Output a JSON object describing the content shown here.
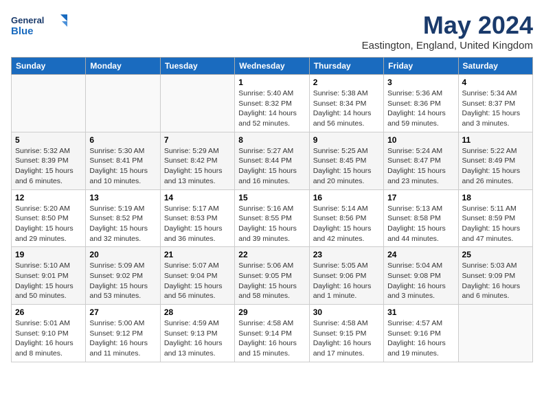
{
  "logo": {
    "text_general": "General",
    "text_blue": "Blue"
  },
  "header": {
    "month_year": "May 2024",
    "location": "Eastington, England, United Kingdom"
  },
  "days_of_week": [
    "Sunday",
    "Monday",
    "Tuesday",
    "Wednesday",
    "Thursday",
    "Friday",
    "Saturday"
  ],
  "weeks": [
    [
      {
        "day": "",
        "info": ""
      },
      {
        "day": "",
        "info": ""
      },
      {
        "day": "",
        "info": ""
      },
      {
        "day": "1",
        "info": "Sunrise: 5:40 AM\nSunset: 8:32 PM\nDaylight: 14 hours and 52 minutes."
      },
      {
        "day": "2",
        "info": "Sunrise: 5:38 AM\nSunset: 8:34 PM\nDaylight: 14 hours and 56 minutes."
      },
      {
        "day": "3",
        "info": "Sunrise: 5:36 AM\nSunset: 8:36 PM\nDaylight: 14 hours and 59 minutes."
      },
      {
        "day": "4",
        "info": "Sunrise: 5:34 AM\nSunset: 8:37 PM\nDaylight: 15 hours and 3 minutes."
      }
    ],
    [
      {
        "day": "5",
        "info": "Sunrise: 5:32 AM\nSunset: 8:39 PM\nDaylight: 15 hours and 6 minutes."
      },
      {
        "day": "6",
        "info": "Sunrise: 5:30 AM\nSunset: 8:41 PM\nDaylight: 15 hours and 10 minutes."
      },
      {
        "day": "7",
        "info": "Sunrise: 5:29 AM\nSunset: 8:42 PM\nDaylight: 15 hours and 13 minutes."
      },
      {
        "day": "8",
        "info": "Sunrise: 5:27 AM\nSunset: 8:44 PM\nDaylight: 15 hours and 16 minutes."
      },
      {
        "day": "9",
        "info": "Sunrise: 5:25 AM\nSunset: 8:45 PM\nDaylight: 15 hours and 20 minutes."
      },
      {
        "day": "10",
        "info": "Sunrise: 5:24 AM\nSunset: 8:47 PM\nDaylight: 15 hours and 23 minutes."
      },
      {
        "day": "11",
        "info": "Sunrise: 5:22 AM\nSunset: 8:49 PM\nDaylight: 15 hours and 26 minutes."
      }
    ],
    [
      {
        "day": "12",
        "info": "Sunrise: 5:20 AM\nSunset: 8:50 PM\nDaylight: 15 hours and 29 minutes."
      },
      {
        "day": "13",
        "info": "Sunrise: 5:19 AM\nSunset: 8:52 PM\nDaylight: 15 hours and 32 minutes."
      },
      {
        "day": "14",
        "info": "Sunrise: 5:17 AM\nSunset: 8:53 PM\nDaylight: 15 hours and 36 minutes."
      },
      {
        "day": "15",
        "info": "Sunrise: 5:16 AM\nSunset: 8:55 PM\nDaylight: 15 hours and 39 minutes."
      },
      {
        "day": "16",
        "info": "Sunrise: 5:14 AM\nSunset: 8:56 PM\nDaylight: 15 hours and 42 minutes."
      },
      {
        "day": "17",
        "info": "Sunrise: 5:13 AM\nSunset: 8:58 PM\nDaylight: 15 hours and 44 minutes."
      },
      {
        "day": "18",
        "info": "Sunrise: 5:11 AM\nSunset: 8:59 PM\nDaylight: 15 hours and 47 minutes."
      }
    ],
    [
      {
        "day": "19",
        "info": "Sunrise: 5:10 AM\nSunset: 9:01 PM\nDaylight: 15 hours and 50 minutes."
      },
      {
        "day": "20",
        "info": "Sunrise: 5:09 AM\nSunset: 9:02 PM\nDaylight: 15 hours and 53 minutes."
      },
      {
        "day": "21",
        "info": "Sunrise: 5:07 AM\nSunset: 9:04 PM\nDaylight: 15 hours and 56 minutes."
      },
      {
        "day": "22",
        "info": "Sunrise: 5:06 AM\nSunset: 9:05 PM\nDaylight: 15 hours and 58 minutes."
      },
      {
        "day": "23",
        "info": "Sunrise: 5:05 AM\nSunset: 9:06 PM\nDaylight: 16 hours and 1 minute."
      },
      {
        "day": "24",
        "info": "Sunrise: 5:04 AM\nSunset: 9:08 PM\nDaylight: 16 hours and 3 minutes."
      },
      {
        "day": "25",
        "info": "Sunrise: 5:03 AM\nSunset: 9:09 PM\nDaylight: 16 hours and 6 minutes."
      }
    ],
    [
      {
        "day": "26",
        "info": "Sunrise: 5:01 AM\nSunset: 9:10 PM\nDaylight: 16 hours and 8 minutes."
      },
      {
        "day": "27",
        "info": "Sunrise: 5:00 AM\nSunset: 9:12 PM\nDaylight: 16 hours and 11 minutes."
      },
      {
        "day": "28",
        "info": "Sunrise: 4:59 AM\nSunset: 9:13 PM\nDaylight: 16 hours and 13 minutes."
      },
      {
        "day": "29",
        "info": "Sunrise: 4:58 AM\nSunset: 9:14 PM\nDaylight: 16 hours and 15 minutes."
      },
      {
        "day": "30",
        "info": "Sunrise: 4:58 AM\nSunset: 9:15 PM\nDaylight: 16 hours and 17 minutes."
      },
      {
        "day": "31",
        "info": "Sunrise: 4:57 AM\nSunset: 9:16 PM\nDaylight: 16 hours and 19 minutes."
      },
      {
        "day": "",
        "info": ""
      }
    ]
  ]
}
